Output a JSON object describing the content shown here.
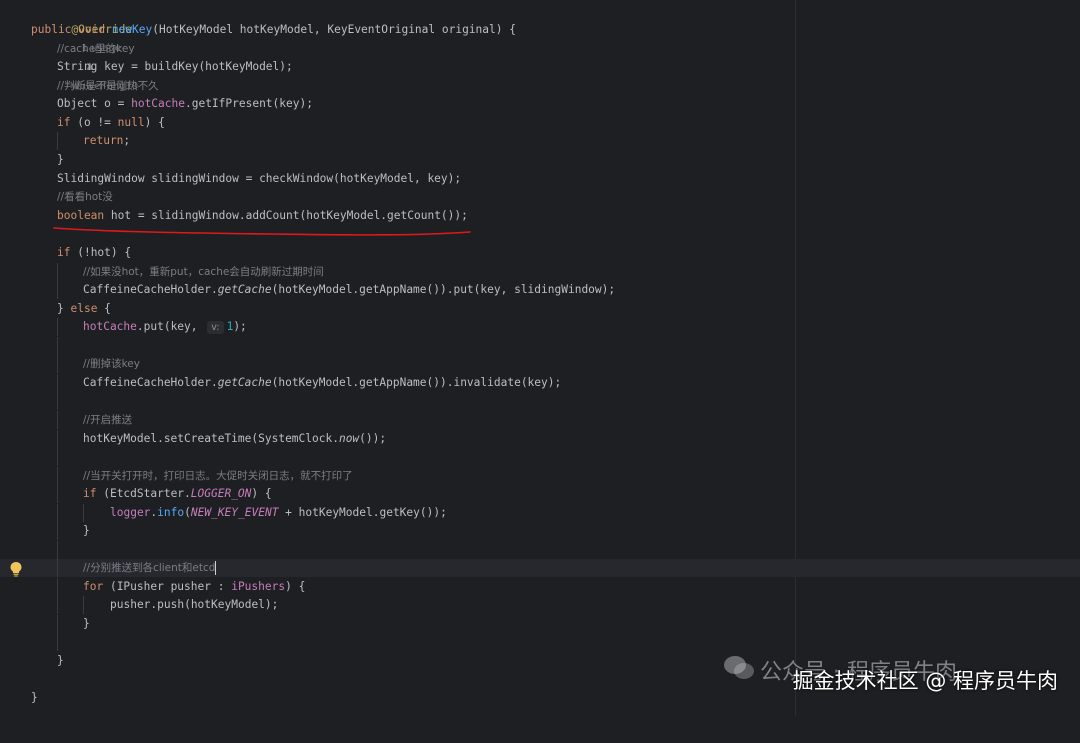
{
  "editor": {
    "lines": {
      "l1": {
        "annotation": "@Override",
        "usages": "1 usage",
        "author": "wuweifeng10"
      },
      "l2": {
        "kw": "public void ",
        "name": "newKey",
        "rest": "(HotKeyModel hotKeyModel, KeyEventOriginal original) {"
      },
      "l3": {
        "comment": "//cache里的key"
      },
      "l4": {
        "text": "String key = buildKey(hotKeyModel);"
      },
      "l5": {
        "comment": "//判断是不是刚热不久"
      },
      "l6": {
        "a": "Object o = ",
        "field": "hotCache",
        "b": ".getIfPresent(key);"
      },
      "l7": {
        "kw": "if",
        "a": " (o != ",
        "kw2": "null",
        "b": ") {"
      },
      "l8": {
        "kw": "return",
        "b": ";"
      },
      "l9": {
        "text": "}"
      },
      "l10": {
        "text": "SlidingWindow slidingWindow = checkWindow(hotKeyModel, key);"
      },
      "l11": {
        "comment": "//看看hot没"
      },
      "l12": {
        "kw": "boolean",
        "b": " hot = slidingWindow.addCount(hotKeyModel.getCount());"
      },
      "l14": {
        "kw": "if",
        "b": " (!hot) {"
      },
      "l15": {
        "comment": "//如果没hot，重新put，cache会自动刷新过期时间"
      },
      "l16": {
        "a": "CaffeineCacheHolder.",
        "it": "getCache",
        "b": "(hotKeyModel.getAppName()).put(key, slidingWindow);"
      },
      "l17": {
        "a": "} ",
        "kw": "else",
        "b": " {"
      },
      "l18": {
        "field": "hotCache",
        "a": ".put(key, ",
        "hint": "v:",
        "num": "1",
        "b": ");"
      },
      "l20": {
        "comment": "//删掉该key"
      },
      "l21": {
        "a": "CaffeineCacheHolder.",
        "it": "getCache",
        "b": "(hotKeyModel.getAppName()).invalidate(key);"
      },
      "l23": {
        "comment": "//开启推送"
      },
      "l24": {
        "a": "hotKeyModel.setCreateTime(SystemClock.",
        "it": "now",
        "b": "());"
      },
      "l26": {
        "comment": "//当开关打开时，打印日志。大促时关闭日志，就不打印了"
      },
      "l27": {
        "kw": "if",
        "a": " (EtcdStarter.",
        "sfield": "LOGGER_ON",
        "b": ") {"
      },
      "l28": {
        "field": "logger",
        "a": ".",
        "fn": "info",
        "b": "(",
        "sfield": "NEW_KEY_EVENT",
        "c": " + hotKeyModel.getKey());"
      },
      "l29": {
        "text": "}"
      },
      "l31": {
        "comment": "//分别推送到各client和etcd"
      },
      "l32": {
        "kw": "for",
        "a": " (IPusher pusher : ",
        "field": "iPushers",
        "b": ") {"
      },
      "l33": {
        "text": "pusher.push(hotKeyModel);"
      },
      "l34": {
        "text": "}"
      },
      "l36": {
        "text": "}"
      },
      "l38": {
        "text": "}"
      }
    }
  },
  "overlay": {
    "wechat_faint": "公众号 · 程序员牛肉",
    "watermark": "掘金技术社区 @ 程序员牛肉"
  },
  "colors": {
    "background": "#1e1f22",
    "keyword": "#cf8e6d",
    "function": "#56a8f5",
    "field": "#c77dbb",
    "comment": "#7a7e85",
    "annotation": "#b3ae60",
    "number": "#2aacb8",
    "underline": "#e0181d"
  }
}
